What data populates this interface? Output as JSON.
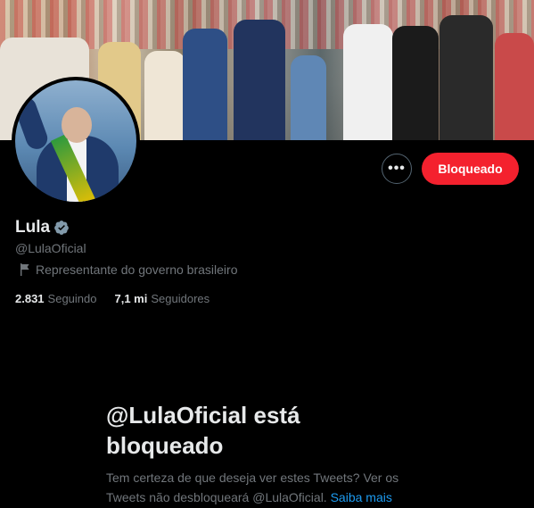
{
  "profile": {
    "name": "Lula",
    "handle": "@LulaOficial",
    "label": "Representante do governo brasileiro",
    "following_count": "2.831",
    "following_label": "Seguindo",
    "followers_count": "7,1 mi",
    "followers_label": "Seguidores"
  },
  "actions": {
    "more_label": "•••",
    "blocked_label": "Bloqueado"
  },
  "blocked_notice": {
    "title": "@LulaOficial está bloqueado",
    "description": "Tem certeza de que deseja ver estes Tweets? Ver os Tweets não desbloqueará @LulaOficial.",
    "link_label": "Saiba mais"
  },
  "icons": {
    "verified": "verified-badge-icon",
    "label_flag": "flag-icon",
    "more": "more-icon"
  },
  "colors": {
    "background": "#000000",
    "blocked_button": "#f4212e",
    "link": "#1d9bf0",
    "secondary_text": "#71767b",
    "primary_text": "#e7e9ea",
    "verified_badge": "#829aab"
  }
}
